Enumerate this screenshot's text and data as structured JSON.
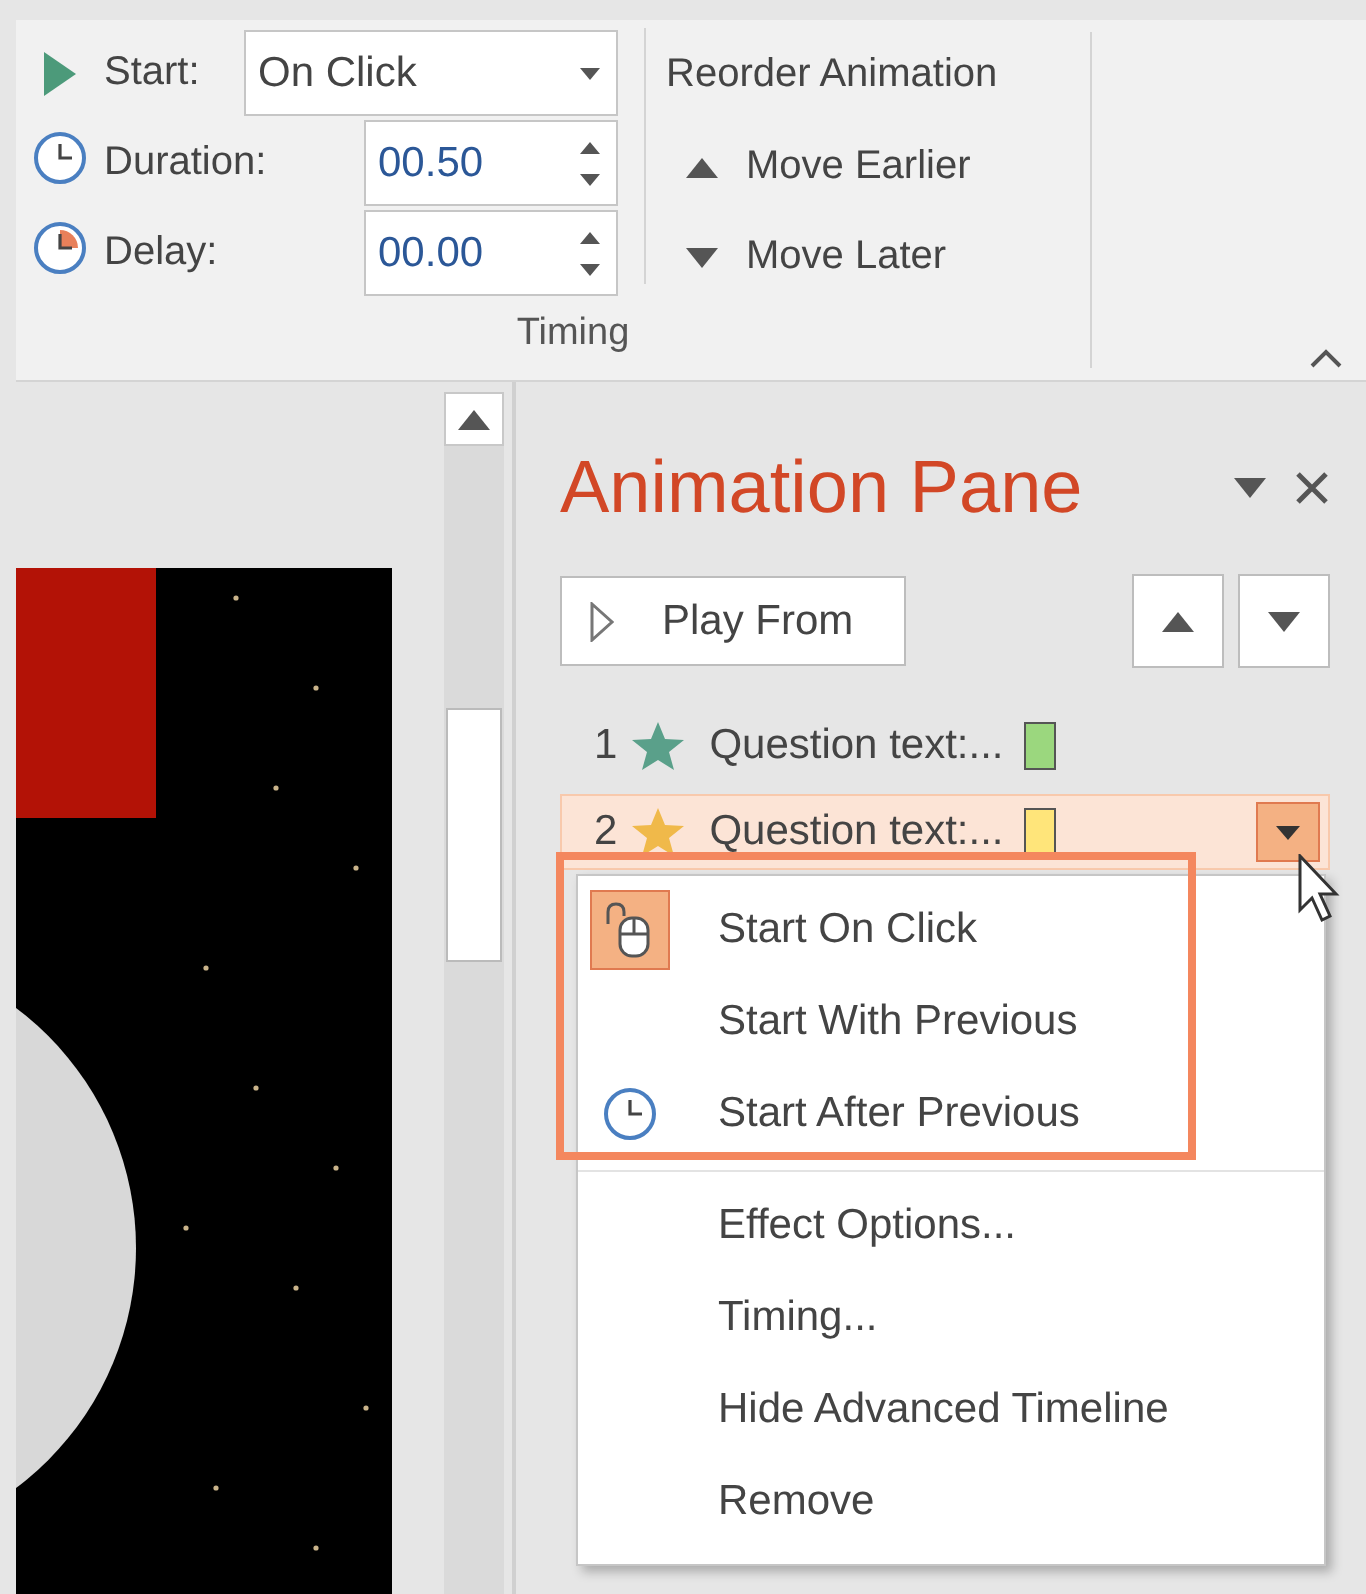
{
  "ribbon": {
    "start": {
      "label": "Start:",
      "value": "On Click"
    },
    "duration": {
      "label": "Duration:",
      "value": "00.50"
    },
    "delay": {
      "label": "Delay:",
      "value": "00.00"
    },
    "reorder": {
      "title": "Reorder Animation",
      "buttons": [
        "Move Earlier",
        "Move Later"
      ]
    },
    "group_label": "Timing"
  },
  "animation_pane": {
    "title": "Animation Pane",
    "play_button": "Play From",
    "items": [
      {
        "number": "1",
        "label": "Question text:...",
        "kind": "entrance",
        "selected": false
      },
      {
        "number": "2",
        "label": "Question text:...",
        "kind": "emphasis",
        "selected": true
      }
    ]
  },
  "context_menu": {
    "start_options": [
      {
        "label": "Start On Click",
        "selected": true
      },
      {
        "label": "Start With Previous",
        "selected": false
      },
      {
        "label": "Start After Previous",
        "selected": false
      }
    ],
    "other_options": [
      "Effect Options...",
      "Timing...",
      "Hide Advanced Timeline",
      "Remove"
    ]
  }
}
